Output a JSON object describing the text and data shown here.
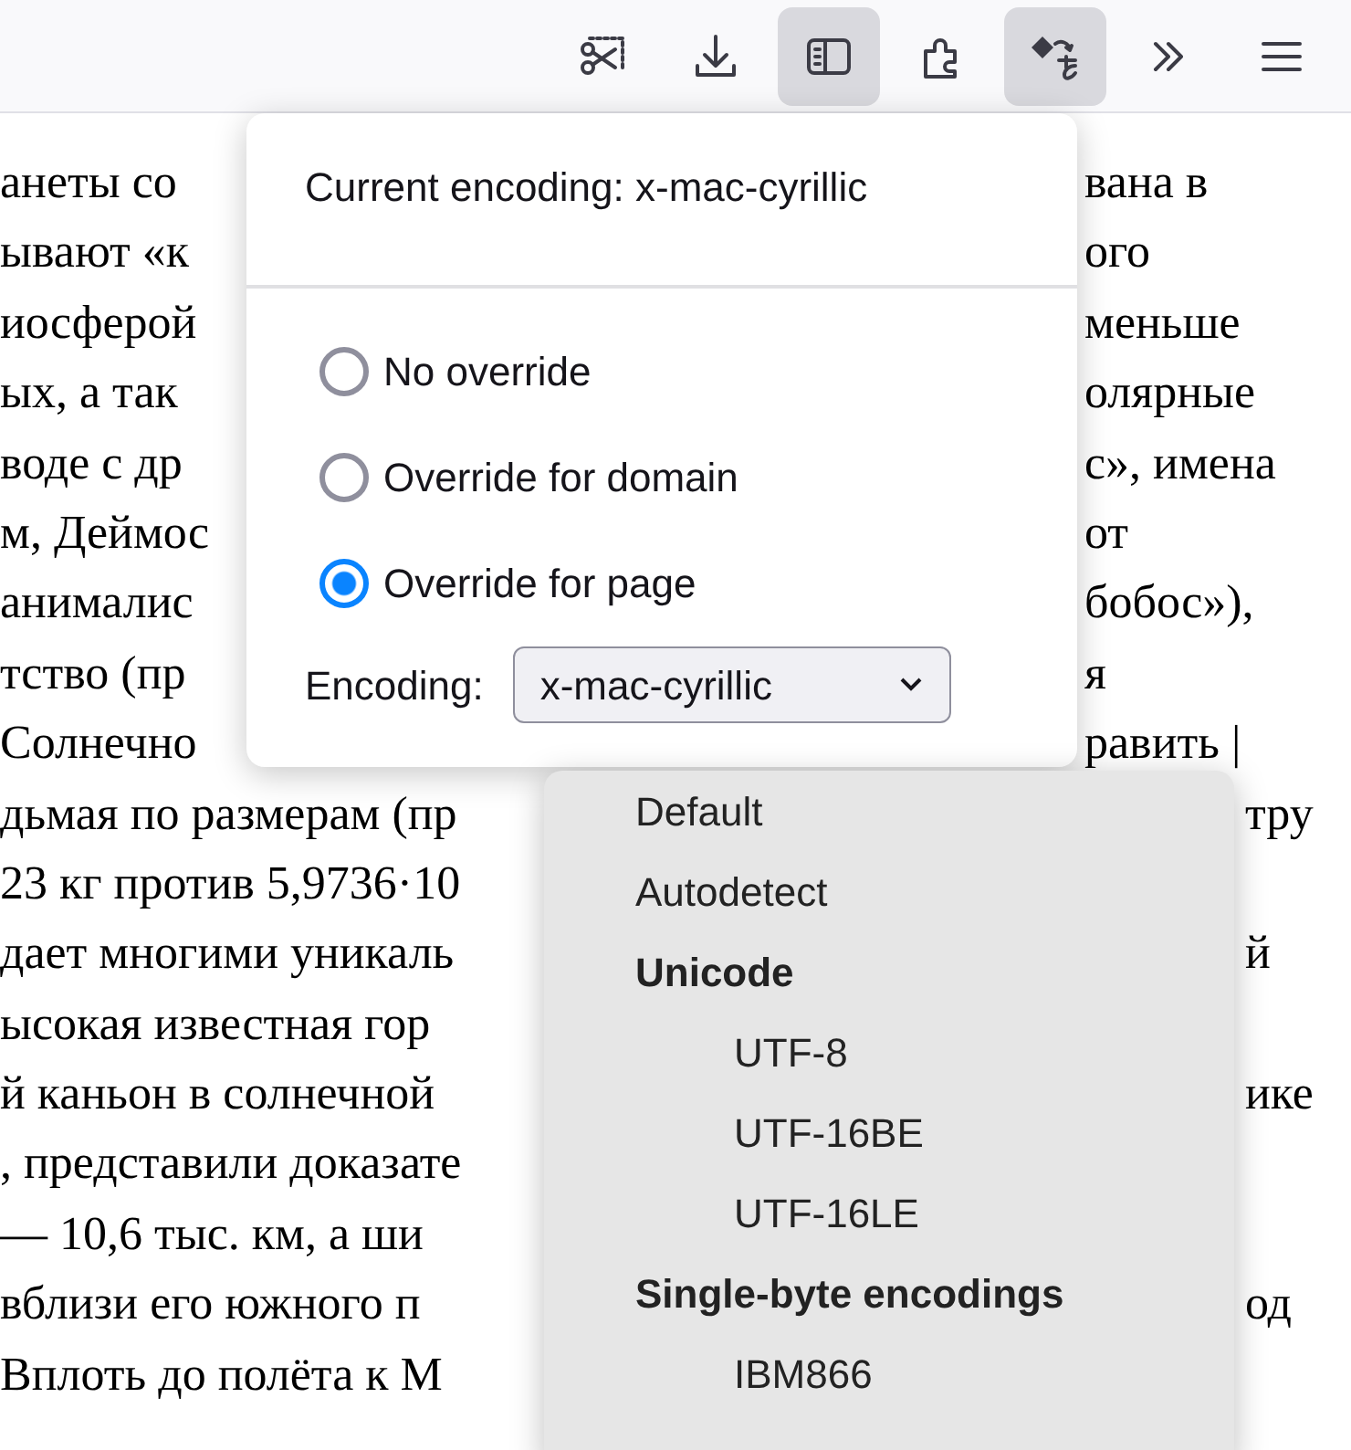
{
  "toolbar": {
    "buttons": [
      {
        "kind": "screenshot",
        "pressed": false
      },
      {
        "kind": "download",
        "pressed": false
      },
      {
        "kind": "sidebar",
        "pressed": true
      },
      {
        "kind": "extensions",
        "pressed": false
      },
      {
        "kind": "translate",
        "pressed": true
      },
      {
        "kind": "overflow",
        "pressed": false
      },
      {
        "kind": "menu",
        "pressed": false
      }
    ]
  },
  "page_text": {
    "lines": [
      {
        "left": "анеты со",
        "right": "вана в"
      },
      {
        "left": "ывают «к",
        "right": "ого"
      },
      {
        "left": "иосферой",
        "right": "меньше"
      },
      {
        "left": "ых, а так",
        "right": "олярные"
      },
      {
        "left": "воде с др",
        "right": "с», имена"
      },
      {
        "left": "м, Деймос",
        "right": "от"
      },
      {
        "left": "анималис",
        "right": "бобос»),"
      },
      {
        "left": "тство (пр",
        "right": "я"
      },
      {
        "left": "Солнечно",
        "right": "равить |"
      },
      {
        "left": "дьмая по размерам (пр",
        "right": "тру"
      },
      {
        "left": "23 кг против 5,9736·10"
      },
      {
        "left": "дает многими уникаль",
        "right": "й"
      },
      {
        "left": "ысокая известная гор"
      },
      {
        "left": "й каньон в солнечной",
        "right": "ике"
      },
      {
        "left": ", представили доказате"
      },
      {
        "left": "— 10,6 тыс. км, а ши"
      },
      {
        "left": "вблизи его южного п",
        "right": "од"
      },
      {
        "left": "Вплоть до полёта к М"
      }
    ]
  },
  "encoding_panel": {
    "current": "Current encoding: x-mac-cyrillic",
    "options": [
      {
        "label": "No override",
        "selected": false
      },
      {
        "label": "Override for domain",
        "selected": false
      },
      {
        "label": "Override for page",
        "selected": true
      }
    ],
    "encoding_label": "Encoding:",
    "select_value": "x-mac-cyrillic"
  },
  "encoding_dropdown": {
    "items": [
      {
        "kind": "option",
        "label": "Default"
      },
      {
        "kind": "option",
        "label": "Autodetect"
      },
      {
        "kind": "group",
        "label": "Unicode",
        "children": [
          {
            "kind": "option",
            "label": "UTF-8"
          },
          {
            "kind": "option",
            "label": "UTF-16BE"
          },
          {
            "kind": "option",
            "label": "UTF-16LE"
          }
        ]
      },
      {
        "kind": "group",
        "label": "Single-byte encodings",
        "children": [
          {
            "kind": "option",
            "label": "IBM866"
          }
        ]
      }
    ]
  }
}
